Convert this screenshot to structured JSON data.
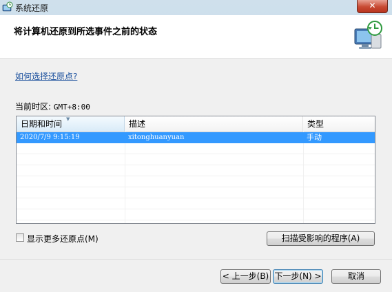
{
  "window": {
    "title": "系统还原",
    "close_glyph": "✕"
  },
  "header": {
    "title": "将计算机还原到所选事件之前的状态",
    "icon": "system-restore-icon"
  },
  "help_link": "如何选择还原点?",
  "timezone": {
    "label": "当前时区:",
    "value": "GMT+8:00"
  },
  "grid": {
    "columns": [
      "日期和时间",
      "描述",
      "类型"
    ],
    "sorted_column": 0,
    "rows": [
      {
        "datetime": "2020/7/9 9:15:19",
        "description": "xitonghuanyuan",
        "type": "手动",
        "selected": true
      }
    ]
  },
  "show_more": {
    "label": "显示更多还原点(M)",
    "checked": false
  },
  "scan_button": "扫描受影响的程序(A)",
  "buttons": {
    "back": "< 上一步(B)",
    "next": "下一步(N) >",
    "cancel": "取消"
  },
  "colors": {
    "selection": "#3399ff",
    "link": "#1a4f9d",
    "close": "#c84a33"
  }
}
